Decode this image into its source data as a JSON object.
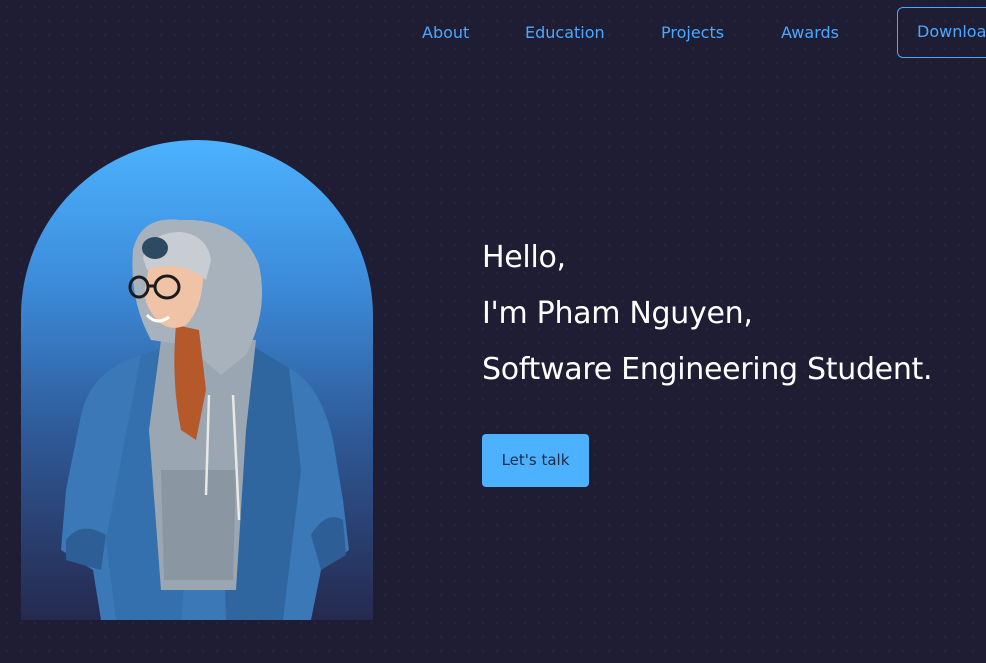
{
  "nav": {
    "items": [
      {
        "label": "About"
      },
      {
        "label": "Education"
      },
      {
        "label": "Projects"
      },
      {
        "label": "Awards"
      }
    ],
    "download_label": "Download CV"
  },
  "hero": {
    "greeting": "Hello,",
    "intro": "I'm Pham Nguyen,",
    "role": "Software Engineering Student.",
    "cta_label": "Let's talk"
  },
  "colors": {
    "background": "#1f1d33",
    "accent": "#4aa8ff",
    "button": "#4cb2ff"
  }
}
